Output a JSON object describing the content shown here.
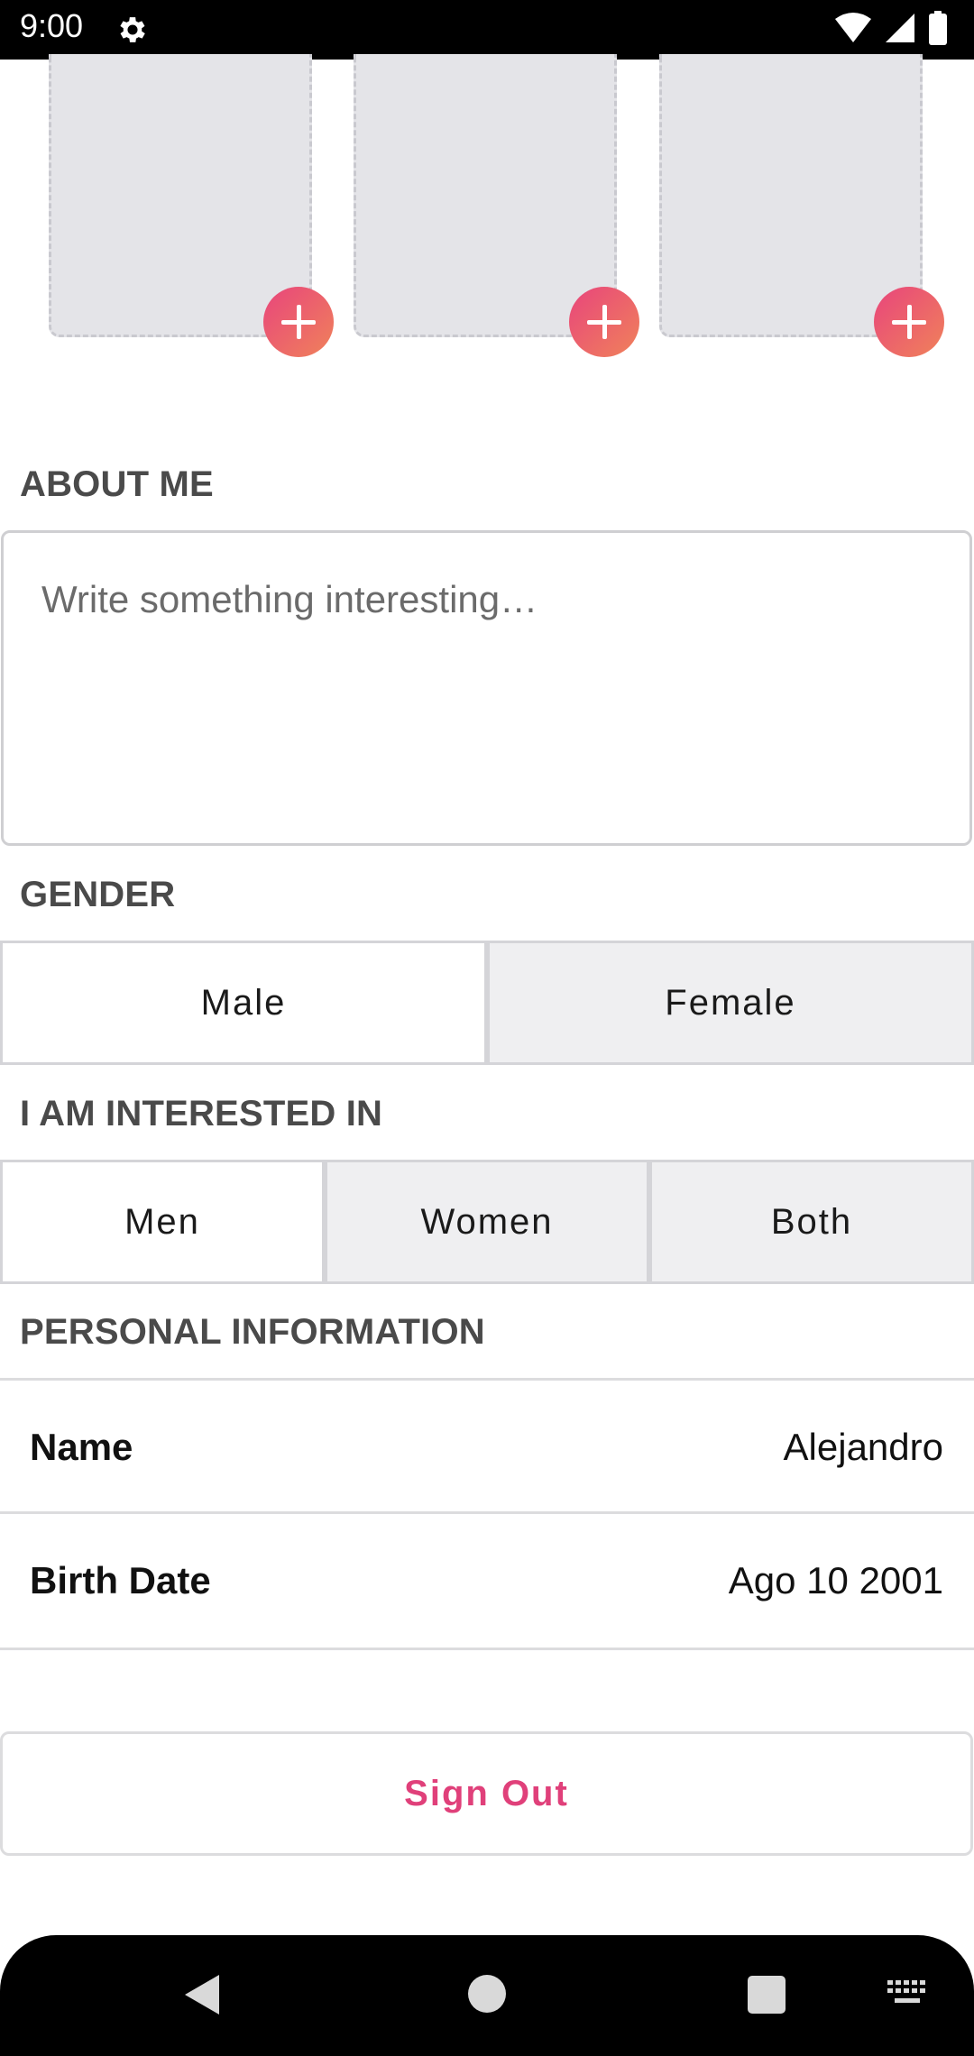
{
  "status_bar": {
    "time": "9:00",
    "icons": [
      "gear-icon",
      "wifi-icon",
      "signal-icon",
      "battery-icon"
    ]
  },
  "photos": {
    "slots": [
      {
        "name": "photo-slot-1",
        "icon": "add-icon"
      },
      {
        "name": "photo-slot-2",
        "icon": "add-icon"
      },
      {
        "name": "photo-slot-3",
        "icon": "add-icon"
      }
    ]
  },
  "about": {
    "title": "ABOUT ME",
    "placeholder": "Write something interesting…",
    "value": ""
  },
  "gender": {
    "title": "GENDER",
    "options": [
      "Male",
      "Female"
    ],
    "selected": "Male"
  },
  "interest": {
    "title": "I AM INTERESTED IN",
    "options": [
      "Men",
      "Women",
      "Both"
    ],
    "selected": "Men"
  },
  "personal": {
    "title": "PERSONAL INFORMATION",
    "rows": [
      {
        "label": "Name",
        "value": "Alejandro"
      },
      {
        "label": "Birth Date",
        "value": "Ago 10 2001"
      }
    ]
  },
  "actions": {
    "sign_out": "Sign Out"
  },
  "colors": {
    "accent": "#e0407a",
    "accent_gradient_end": "#f0825a",
    "segment_unselected": "#efeff1"
  },
  "nav_bar": {
    "icons": [
      "back-icon",
      "home-icon",
      "recents-icon",
      "keyboard-icon"
    ]
  }
}
